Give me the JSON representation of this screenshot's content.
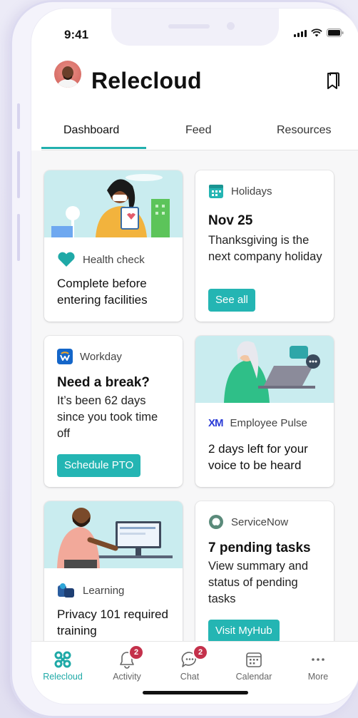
{
  "status_bar": {
    "time": "9:41"
  },
  "header": {
    "title": "Relecloud"
  },
  "tabs": [
    {
      "label": "Dashboard",
      "active": true
    },
    {
      "label": "Feed",
      "active": false
    },
    {
      "label": "Resources",
      "active": false
    }
  ],
  "cards": {
    "health": {
      "meta": "Health check",
      "body": "Complete before entering facilities"
    },
    "holidays": {
      "meta": "Holidays",
      "title": "Nov 25",
      "body": "Thanksgiving is the next company holiday",
      "button": "See all"
    },
    "workday": {
      "meta": "Workday",
      "title": "Need a break?",
      "body": "It’s been 62 days since you took time off",
      "button": "Schedule PTO"
    },
    "pulse": {
      "meta": "Employee Pulse",
      "logo": "XM",
      "body": "2 days left for your voice to be heard"
    },
    "learning": {
      "meta": "Learning",
      "body": "Privacy 101 required training"
    },
    "servicenow": {
      "meta": "ServiceNow",
      "title": "7 pending tasks",
      "body": "View summary and status of pending tasks",
      "button": "Visit MyHub"
    }
  },
  "tabbar": [
    {
      "label": "Relecloud",
      "icon": "relecloud-icon",
      "active": true
    },
    {
      "label": "Activity",
      "icon": "bell-icon",
      "badge": "2"
    },
    {
      "label": "Chat",
      "icon": "chat-icon",
      "badge": "2"
    },
    {
      "label": "Calendar",
      "icon": "calendar-icon"
    },
    {
      "label": "More",
      "icon": "more-icon"
    }
  ],
  "colors": {
    "accent": "#24b5b3",
    "badge": "#c4314b",
    "illustration_bg": "#c9ecef",
    "heart": "#1fa9a7"
  }
}
